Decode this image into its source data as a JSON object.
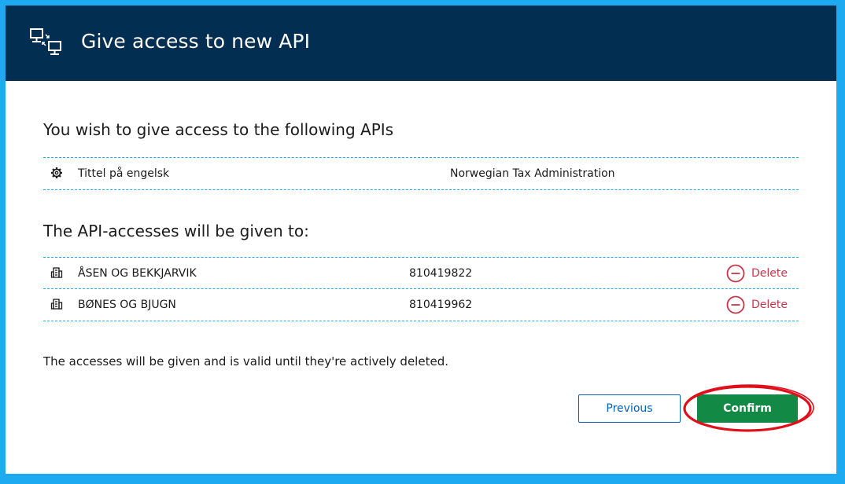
{
  "dialog": {
    "title": "Give access to new API",
    "icon": "computers-icon"
  },
  "apis_section": {
    "heading": "You wish to give access to the following APIs",
    "items": [
      {
        "icon": "gear-icon",
        "name": "Tittel på engelsk",
        "owner": "Norwegian Tax Administration"
      }
    ]
  },
  "recipients_section": {
    "heading": "The API-accesses will be given to:",
    "items": [
      {
        "icon": "building-icon",
        "name": "ÅSEN OG BEKKJARVIK",
        "org_number": "810419822",
        "delete_label": "Delete"
      },
      {
        "icon": "building-icon",
        "name": "BØNES OG BJUGN",
        "org_number": "810419962",
        "delete_label": "Delete"
      }
    ]
  },
  "footnote": "The accesses will be given and is valid until they're actively deleted.",
  "buttons": {
    "previous": "Previous",
    "confirm": "Confirm"
  },
  "colors": {
    "background": "#1eaaf1",
    "header": "#022f51",
    "confirm": "#128944",
    "previous_border": "#0062ba",
    "delete": "#c9354a",
    "annotation": "#e0101b"
  }
}
